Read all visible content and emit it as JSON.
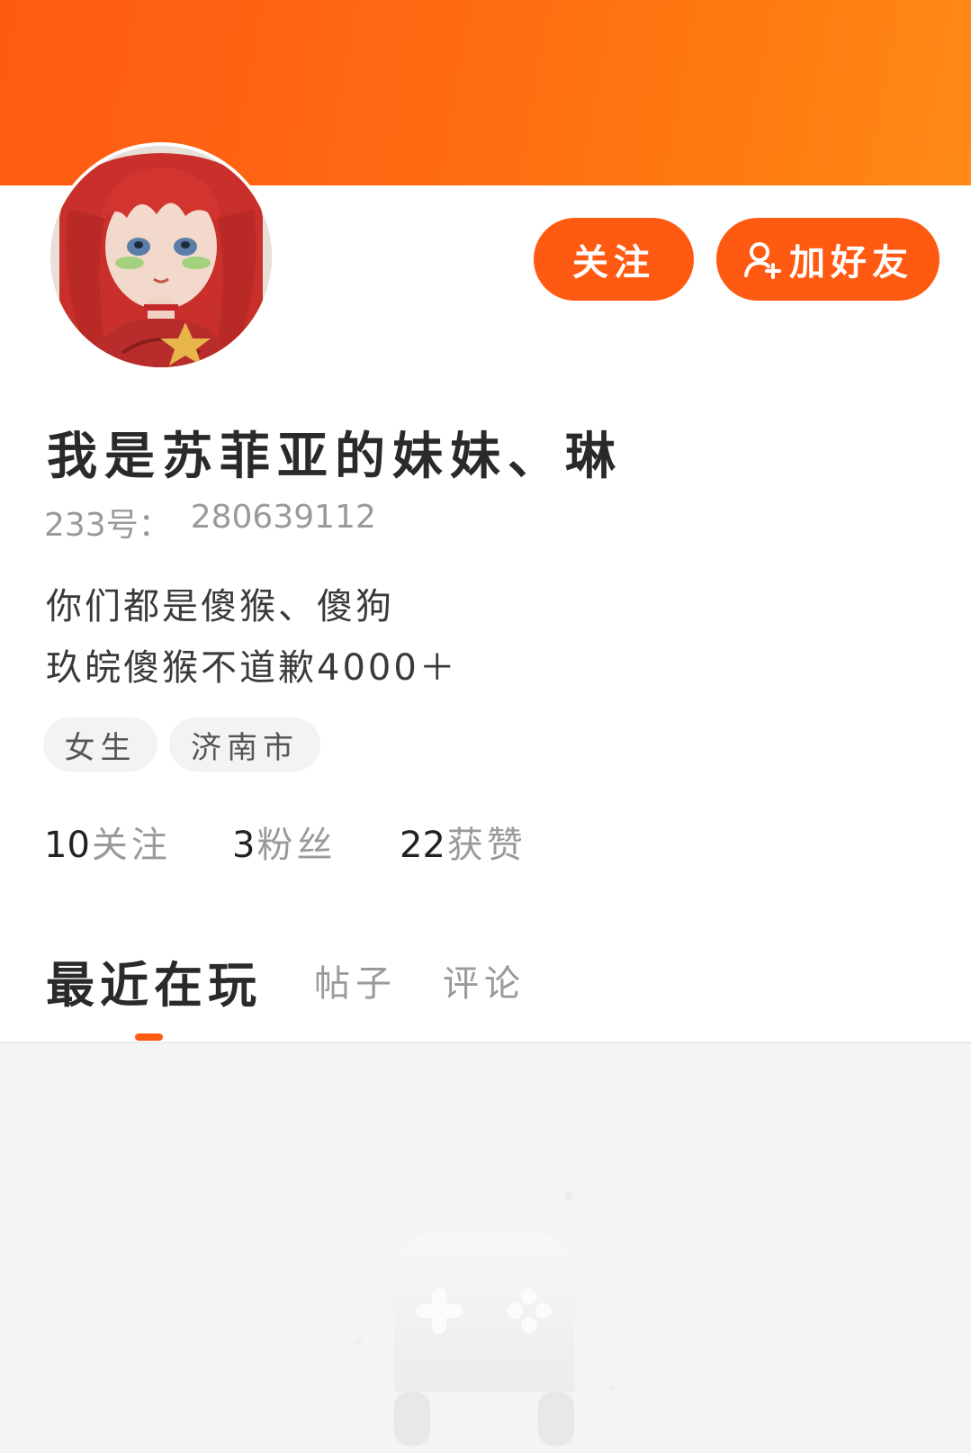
{
  "theme": {
    "accent": "#ff5a12",
    "banner_start": "#ff5a12",
    "banner_end": "#ff8a18"
  },
  "profile": {
    "name": "我是苏菲亚的妹妹、琳",
    "id_label": "233号：",
    "id_value": "280639112",
    "bio_line1": "你们都是傻猴、傻狗",
    "bio_line2": "玖皖傻猴不道歉4000＋",
    "tags": [
      "女生",
      "济南市"
    ]
  },
  "actions": {
    "follow_label": "关注",
    "add_friend_label": "加好友",
    "add_friend_icon": "person-add-icon"
  },
  "stats": [
    {
      "count": "10",
      "label": "关注"
    },
    {
      "count": "3",
      "label": "粉丝"
    },
    {
      "count": "22",
      "label": "获赞"
    }
  ],
  "tabs": [
    {
      "label": "最近在玩",
      "active": true
    },
    {
      "label": "帖子",
      "active": false
    },
    {
      "label": "评论",
      "active": false
    }
  ],
  "empty_state": {
    "icon": "gamepad-icon"
  }
}
